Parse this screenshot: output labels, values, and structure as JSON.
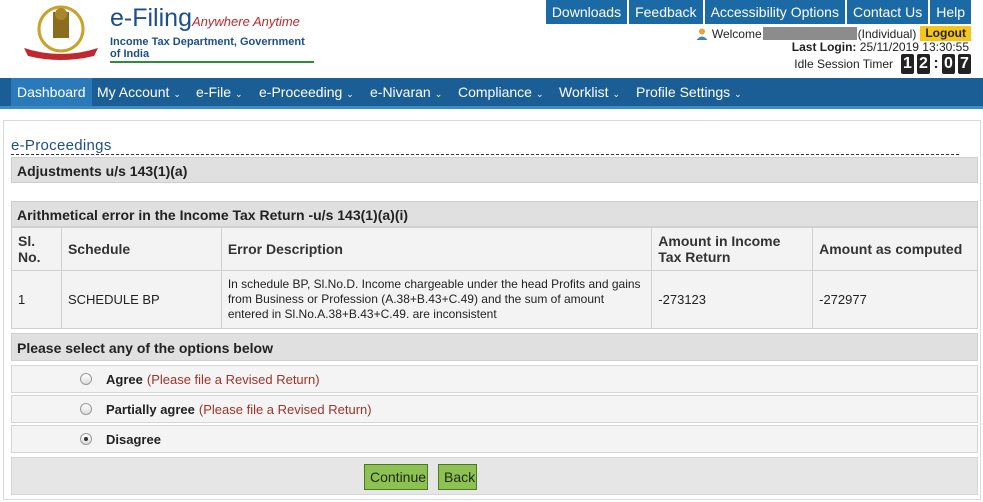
{
  "brand": {
    "title": "e-Filing",
    "tagline": "Anywhere Anytime",
    "department": "Income Tax Department, Government of India",
    "logo_text": "INCOME TAX DEPARTMENT"
  },
  "toplinks": [
    "Downloads",
    "Feedback",
    "Accessibility Options",
    "Contact Us",
    "Help"
  ],
  "user": {
    "welcome": "Welcome",
    "role": "(Individual)",
    "logout": "Logout",
    "last_login_label": "Last Login:",
    "last_login_value": "25/11/2019 13:30:55",
    "idle_label": "Idle Session Timer",
    "timer_digits": [
      "1",
      "2",
      "0",
      "7"
    ]
  },
  "nav": [
    {
      "label": "Dashboard",
      "caret": ""
    },
    {
      "label": "My Account",
      "caret": "⌄"
    },
    {
      "label": "e-File",
      "caret": "⌄"
    },
    {
      "label": "e-Proceeding",
      "caret": "⌄"
    },
    {
      "label": "e-Nivaran",
      "caret": "⌄"
    },
    {
      "label": "Compliance",
      "caret": "⌄"
    },
    {
      "label": "Worklist",
      "caret": "⌄"
    },
    {
      "label": "Profile Settings",
      "caret": "⌄"
    }
  ],
  "page": {
    "title": "e-Proceedings",
    "section": "Adjustments u/s 143(1)(a)",
    "subsection": "Arithmetical error in the Income Tax Return -u/s 143(1)(a)(i)"
  },
  "table": {
    "headers": [
      "Sl. No.",
      "Schedule",
      "Error Description",
      "Amount in Income Tax Return",
      "Amount as computed"
    ],
    "rows": [
      {
        "sl": "1",
        "schedule": "SCHEDULE BP",
        "description": "In schedule BP, Sl.No.D. Income chargeable under the head Profits and gains from Business or Profession (A.38+B.43+C.49) and the sum of amount entered in Sl.No.A.38+B.43+C.49. are inconsistent",
        "amount_return": "-273123",
        "amount_computed": "-272977"
      }
    ]
  },
  "options": {
    "prompt": "Please select any of the options below",
    "items": [
      {
        "label": "Agree",
        "note": "(Please file a Revised Return)",
        "checked": false
      },
      {
        "label": "Partially agree",
        "note": "(Please file a Revised Return)",
        "checked": false
      },
      {
        "label": "Disagree",
        "note": "",
        "checked": true
      }
    ]
  },
  "buttons": {
    "continue": "Continue",
    "back": "Back"
  },
  "colors": {
    "brand_blue": "#1c4f8a",
    "nav_blue": "#1b5e95",
    "logout_yellow": "#f5c518",
    "button_green": "#8dc153",
    "note_red": "#a0322a"
  }
}
